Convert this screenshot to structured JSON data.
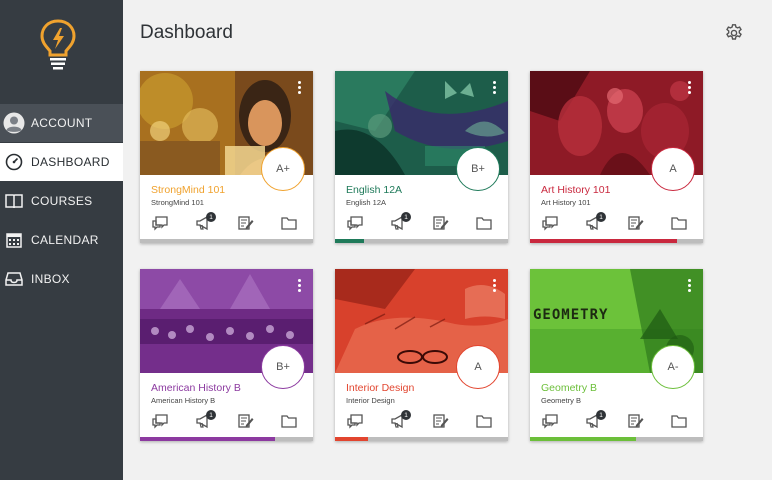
{
  "page": {
    "title": "Dashboard"
  },
  "sidebar": {
    "items": [
      {
        "label": "ACCOUNT",
        "icon": "avatar-icon"
      },
      {
        "label": "DASHBOARD",
        "icon": "speedometer-icon"
      },
      {
        "label": "COURSES",
        "icon": "book-icon"
      },
      {
        "label": "CALENDAR",
        "icon": "calendar-icon"
      },
      {
        "label": "INBOX",
        "icon": "inbox-icon"
      }
    ],
    "active": "DASHBOARD"
  },
  "courses": [
    {
      "title": "StrongMind 101",
      "subtitle": "StrongMind 101",
      "grade": "A+",
      "accent": "#f0a22e",
      "progress": 0,
      "announcements": "1"
    },
    {
      "title": "English 12A",
      "subtitle": "English 12A",
      "grade": "B+",
      "accent": "#1f7a5a",
      "progress": 0.17,
      "announcements": "1"
    },
    {
      "title": "Art History 101",
      "subtitle": "Art History 101",
      "grade": "A",
      "accent": "#c9283e",
      "progress": 0.85,
      "announcements": "1"
    },
    {
      "title": "American History B",
      "subtitle": "American History B",
      "grade": "B+",
      "accent": "#8c3aa0",
      "progress": 0.78,
      "announcements": "1"
    },
    {
      "title": "Interior Design",
      "subtitle": "Interior Design",
      "grade": "A",
      "accent": "#e2452f",
      "progress": 0.19,
      "announcements": "1"
    },
    {
      "title": "Geometry B",
      "subtitle": "Geometry B",
      "grade": "A-",
      "accent": "#6cbf3a",
      "progress": 0.61,
      "announcements": "1",
      "hero_text": "GEOMETRY"
    }
  ],
  "colors": {
    "sidebar": "#363c42",
    "logo": "#f0a22e",
    "background": "#f1f1f1"
  }
}
